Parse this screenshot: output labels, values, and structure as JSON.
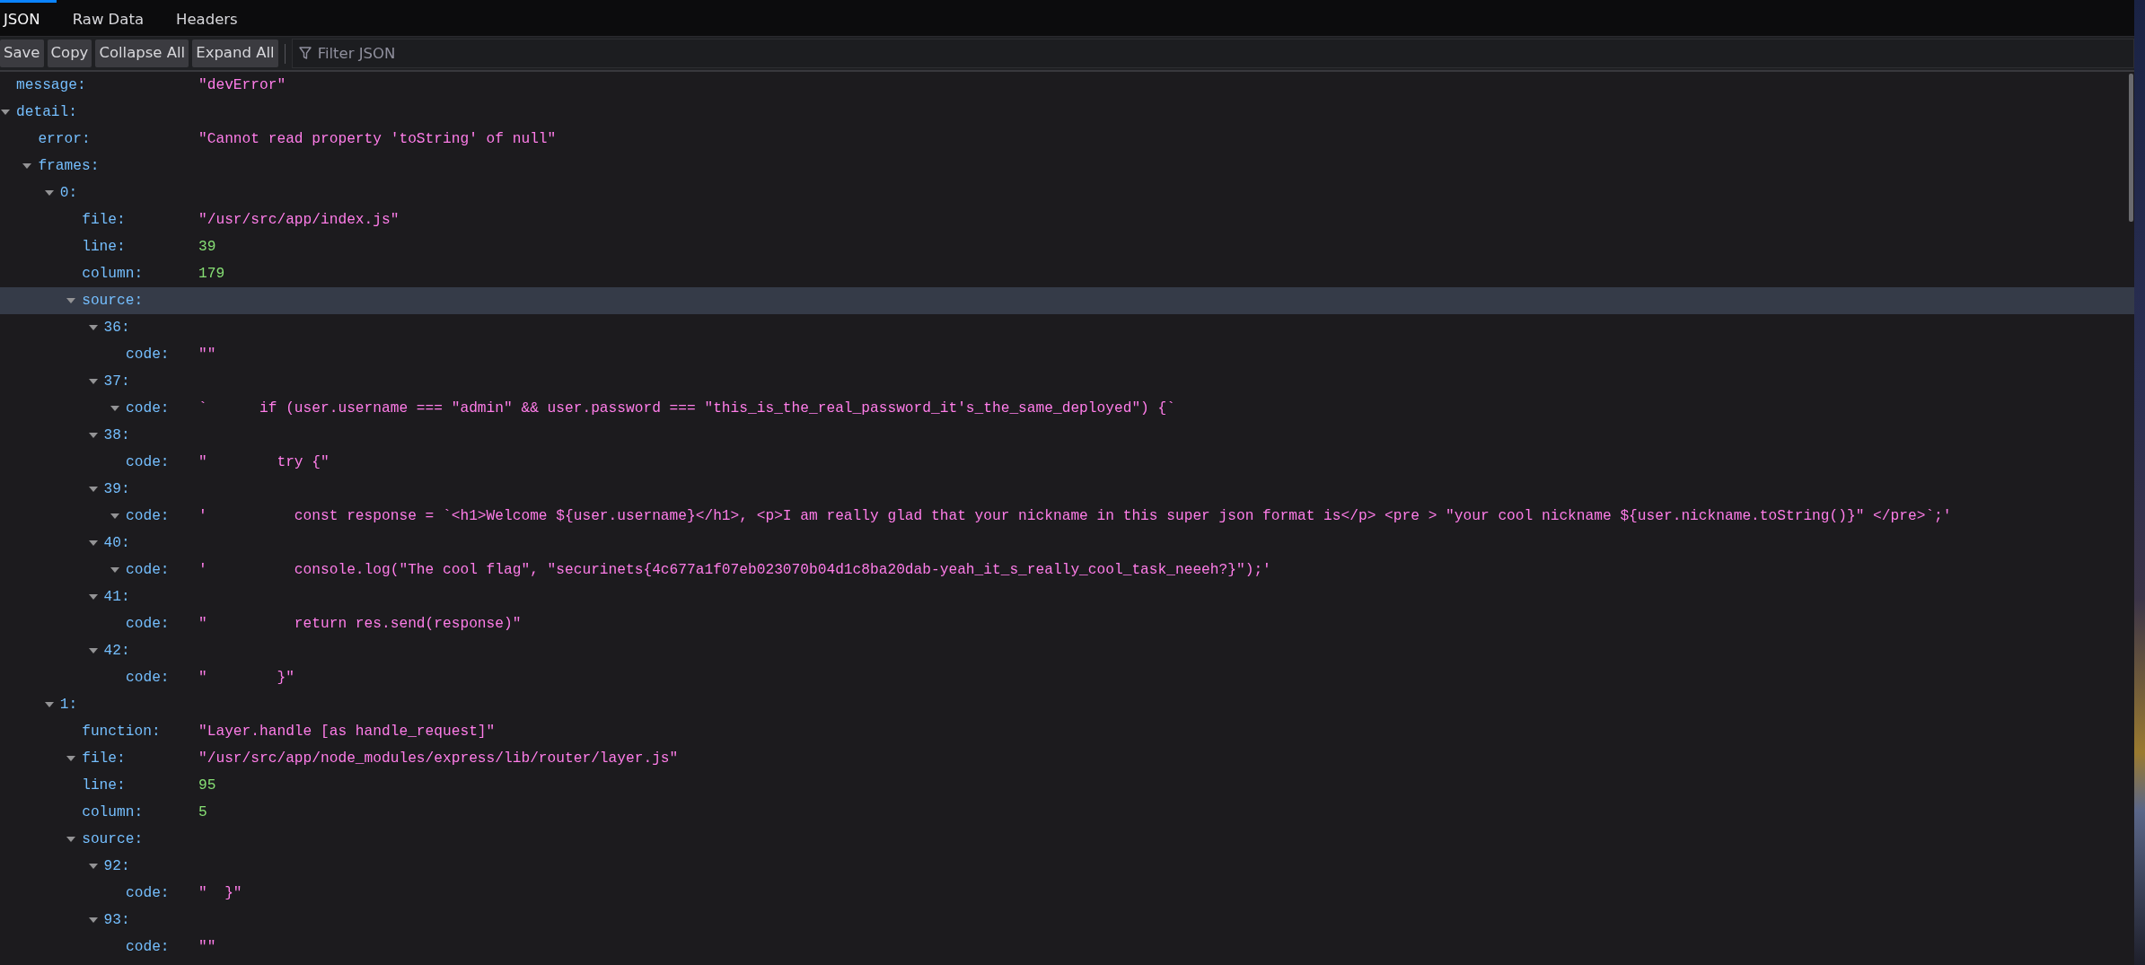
{
  "tabs": [
    {
      "label": "JSON",
      "selected": true
    },
    {
      "label": "Raw Data",
      "selected": false
    },
    {
      "label": "Headers",
      "selected": false
    }
  ],
  "toolbar": {
    "buttons": [
      "Save",
      "Copy",
      "Collapse All",
      "Expand All"
    ],
    "filter": {
      "placeholder": "Filter JSON"
    }
  },
  "tree": [
    {
      "key": "message:",
      "kind": "string",
      "value": "\"devError\"",
      "selected": false
    },
    {
      "key": "detail:",
      "expanded": true,
      "selected": false,
      "children": [
        {
          "key": "error:",
          "kind": "string",
          "value": "\"Cannot read property 'toString' of null\"",
          "selected": false
        },
        {
          "key": "frames:",
          "expanded": true,
          "selected": false,
          "children": [
            {
              "key": "0:",
              "expanded": true,
              "selected": false,
              "children": [
                {
                  "key": "file:",
                  "kind": "string",
                  "value": "\"/usr/src/app/index.js\"",
                  "selected": false
                },
                {
                  "key": "line:",
                  "kind": "number",
                  "value": "39",
                  "selected": false
                },
                {
                  "key": "column:",
                  "kind": "number",
                  "value": "179",
                  "selected": false
                },
                {
                  "key": "source:",
                  "expanded": true,
                  "selected": true,
                  "children": [
                    {
                      "key": "36:",
                      "expanded": true,
                      "selected": false,
                      "children": [
                        {
                          "key": "code:",
                          "kind": "string",
                          "value": "\"\"",
                          "selected": false
                        }
                      ]
                    },
                    {
                      "key": "37:",
                      "expanded": true,
                      "selected": false,
                      "children": [
                        {
                          "key": "code:",
                          "kind": "string",
                          "value": "`      if (user.username === \"admin\" && user.password === \"this_is_the_real_password_it's_the_same_deployed\") {`",
                          "expanded": true,
                          "selected": false
                        }
                      ]
                    },
                    {
                      "key": "38:",
                      "expanded": true,
                      "selected": false,
                      "children": [
                        {
                          "key": "code:",
                          "kind": "string",
                          "value": "\"        try {\"",
                          "selected": false
                        }
                      ]
                    },
                    {
                      "key": "39:",
                      "expanded": true,
                      "selected": false,
                      "children": [
                        {
                          "key": "code:",
                          "kind": "string",
                          "value": "'          const response = `<h1>Welcome ${user.username}</h1>, <p>I am really glad that your nickname in this super json format is</p> <pre > \"your cool nickname ${user.nickname.toString()}\" </pre>`;'",
                          "expanded": true,
                          "selected": false
                        }
                      ]
                    },
                    {
                      "key": "40:",
                      "expanded": true,
                      "selected": false,
                      "children": [
                        {
                          "key": "code:",
                          "kind": "string",
                          "value": "'          console.log(\"The cool flag\", \"securinets{4c677a1f07eb023070b04d1c8ba20dab-yeah_it_s_really_cool_task_neeeh?}\");'",
                          "expanded": true,
                          "selected": false
                        }
                      ]
                    },
                    {
                      "key": "41:",
                      "expanded": true,
                      "selected": false,
                      "children": [
                        {
                          "key": "code:",
                          "kind": "string",
                          "value": "\"          return res.send(response)\"",
                          "selected": false
                        }
                      ]
                    },
                    {
                      "key": "42:",
                      "expanded": true,
                      "selected": false,
                      "children": [
                        {
                          "key": "code:",
                          "kind": "string",
                          "value": "\"        }\"",
                          "selected": false
                        }
                      ]
                    }
                  ]
                }
              ]
            },
            {
              "key": "1:",
              "expanded": true,
              "selected": false,
              "children": [
                {
                  "key": "function:",
                  "kind": "string",
                  "value": "\"Layer.handle [as handle_request]\"",
                  "selected": false
                },
                {
                  "key": "file:",
                  "kind": "string",
                  "value": "\"/usr/src/app/node_modules/express/lib/router/layer.js\"",
                  "expanded": true,
                  "selected": false
                },
                {
                  "key": "line:",
                  "kind": "number",
                  "value": "95",
                  "selected": false
                },
                {
                  "key": "column:",
                  "kind": "number",
                  "value": "5",
                  "selected": false
                },
                {
                  "key": "source:",
                  "expanded": true,
                  "selected": false,
                  "children": [
                    {
                      "key": "92:",
                      "expanded": true,
                      "selected": false,
                      "children": [
                        {
                          "key": "code:",
                          "kind": "string",
                          "value": "\"  }\"",
                          "selected": false
                        }
                      ]
                    },
                    {
                      "key": "93:",
                      "expanded": true,
                      "selected": false,
                      "children": [
                        {
                          "key": "code:",
                          "kind": "string",
                          "value": "\"\"",
                          "selected": false
                        }
                      ]
                    }
                  ]
                }
              ]
            }
          ]
        }
      ]
    }
  ]
}
